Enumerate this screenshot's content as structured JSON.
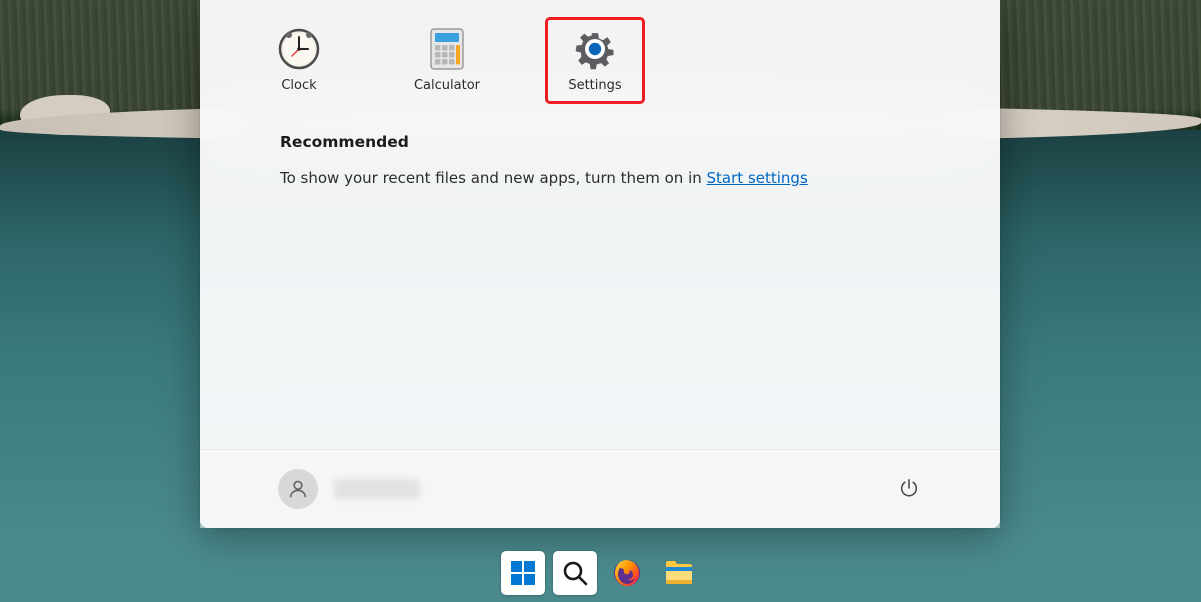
{
  "start_menu": {
    "apps": [
      {
        "label": "Clock",
        "icon": "clock-icon"
      },
      {
        "label": "Calculator",
        "icon": "calculator-icon"
      },
      {
        "label": "Settings",
        "icon": "settings-icon",
        "highlighted": true
      }
    ],
    "recommended": {
      "heading": "Recommended",
      "text": "To show your recent files and new apps, turn them on in ",
      "link_text": "Start settings"
    },
    "user": {
      "name": ""
    },
    "power_label": "Power"
  },
  "taskbar": {
    "items": [
      {
        "name": "start",
        "icon": "windows-icon",
        "active": true
      },
      {
        "name": "search",
        "icon": "search-icon",
        "active": true
      },
      {
        "name": "firefox",
        "icon": "firefox-icon",
        "active": false
      },
      {
        "name": "file-explorer",
        "icon": "explorer-icon",
        "active": false
      }
    ]
  },
  "highlight_color": "#ef1c23"
}
